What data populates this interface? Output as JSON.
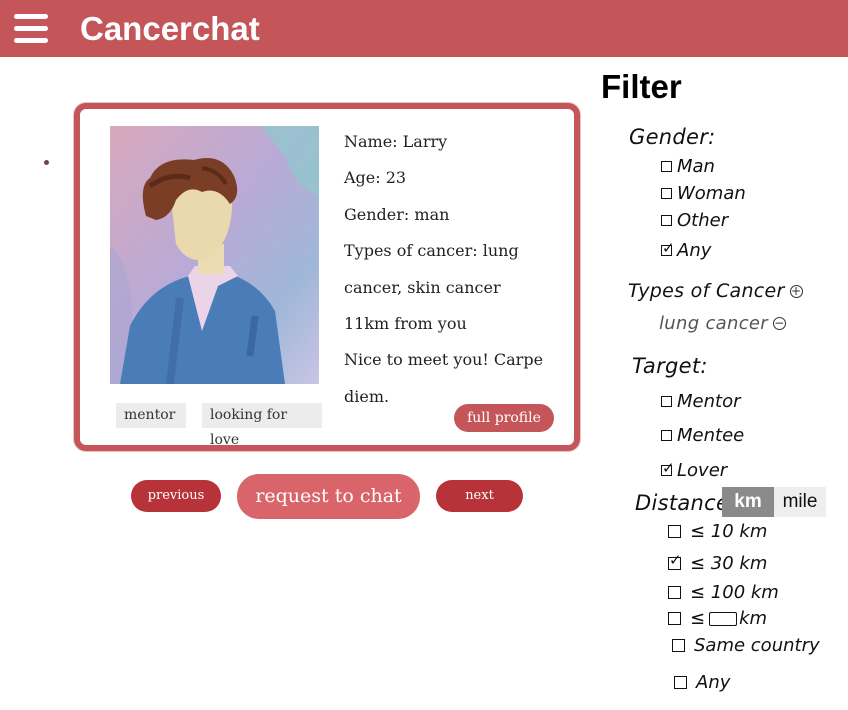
{
  "header": {
    "title": "Cancerchat",
    "menu_icon": "hamburger-menu-icon"
  },
  "profile": {
    "name": "Name: Larry",
    "age": "Age: 23",
    "gender": "Gender: man",
    "cancer_line1": "Types of cancer: lung",
    "cancer_line2": "cancer, skin cancer",
    "distance": "11km from you",
    "bio_line1": "Nice to meet you! Carpe",
    "bio_line2": "diem.",
    "tags": [
      "mentor",
      "looking for love"
    ],
    "full_profile_label": "full profile"
  },
  "actions": {
    "previous": "previous",
    "request": "request to chat",
    "next": "next"
  },
  "filter": {
    "title": "Filter",
    "gender": {
      "label": "Gender:",
      "options": [
        "Man",
        "Woman",
        "Other",
        "Any"
      ],
      "checked": "Any"
    },
    "cancer": {
      "label": "Types of Cancer",
      "selected": "lung cancer"
    },
    "target": {
      "label": "Target:",
      "options": [
        "Mentor",
        "Mentee",
        "Lover"
      ],
      "checked": "Lover"
    },
    "distance": {
      "label": "Distance",
      "unit_km": "km",
      "unit_mile": "mile",
      "selected_unit": "km",
      "opt_10": "≤ 10 km",
      "opt_30": "≤ 30 km",
      "opt_100": "≤ 100 km",
      "opt_custom_prefix": "≤",
      "opt_custom_suffix": "km",
      "opt_country": "Same country",
      "opt_any": "Any",
      "checked": "≤ 30 km"
    }
  },
  "colors": {
    "brand": "#c4565a",
    "button_dark": "#b8323a",
    "button_light": "#d9646a"
  }
}
